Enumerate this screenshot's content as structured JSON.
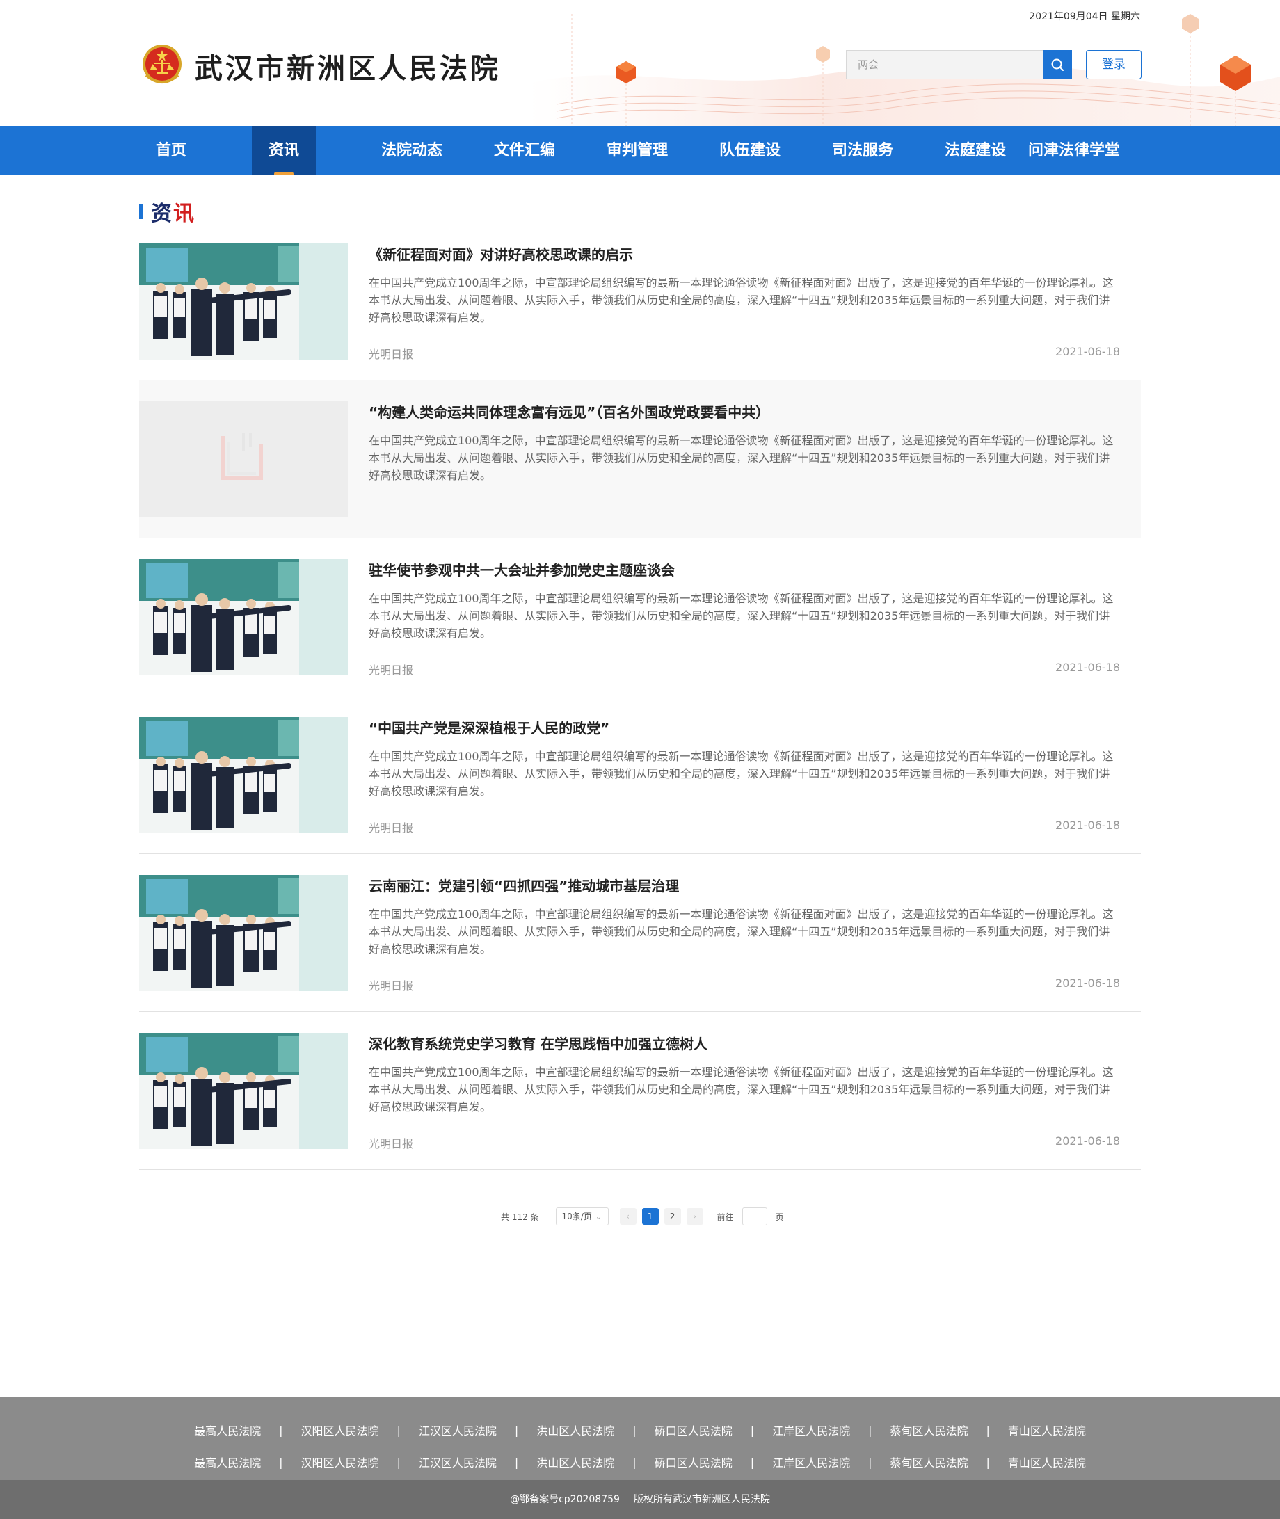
{
  "header": {
    "date": "2021年09月04日 星期六",
    "site_title": "武汉市新洲区人民法院",
    "search_placeholder": "两会",
    "login_label": "登录"
  },
  "nav": {
    "items": [
      {
        "label": "首页"
      },
      {
        "label": "资讯"
      },
      {
        "label": "法院动态"
      },
      {
        "label": "文件汇编"
      },
      {
        "label": "审判管理"
      },
      {
        "label": "队伍建设"
      },
      {
        "label": "司法服务"
      },
      {
        "label": "法庭建设"
      },
      {
        "label": "问津法律学堂"
      }
    ],
    "active_index": 1
  },
  "section": {
    "title_part1": "资",
    "title_part2": "讯"
  },
  "articles": [
    {
      "title": "《新征程面对面》对讲好高校思政课的启示",
      "summary": "在中国共产党成立100周年之际，中宣部理论局组织编写的最新一本理论通俗读物《新征程面对面》出版了，这是迎接党的百年华诞的一份理论厚礼。这本书从大局出发、从问题着眼、从实际入手，带领我们从历史和全局的高度，深入理解“十四五”规划和2035年远景目标的一系列重大问题，对于我们讲好高校思政课深有启发。",
      "source": "光明日报",
      "date": "2021-06-18",
      "has_image": true
    },
    {
      "title": "“构建人类命运共同体理念富有远见”（百名外国政党政要看中共）",
      "summary": "在中国共产党成立100周年之际，中宣部理论局组织编写的最新一本理论通俗读物《新征程面对面》出版了，这是迎接党的百年华诞的一份理论厚礼。这本书从大局出发、从问题着眼、从实际入手，带领我们从历史和全局的高度，深入理解“十四五”规划和2035年远景目标的一系列重大问题，对于我们讲好高校思政课深有启发。",
      "source": "",
      "date": "",
      "has_image": false
    },
    {
      "title": "驻华使节参观中共一大会址并参加党史主题座谈会",
      "summary": "在中国共产党成立100周年之际，中宣部理论局组织编写的最新一本理论通俗读物《新征程面对面》出版了，这是迎接党的百年华诞的一份理论厚礼。这本书从大局出发、从问题着眼、从实际入手，带领我们从历史和全局的高度，深入理解“十四五”规划和2035年远景目标的一系列重大问题，对于我们讲好高校思政课深有启发。",
      "source": "光明日报",
      "date": "2021-06-18",
      "has_image": true
    },
    {
      "title": "“中国共产党是深深植根于人民的政党”",
      "summary": "在中国共产党成立100周年之际，中宣部理论局组织编写的最新一本理论通俗读物《新征程面对面》出版了，这是迎接党的百年华诞的一份理论厚礼。这本书从大局出发、从问题着眼、从实际入手，带领我们从历史和全局的高度，深入理解“十四五”规划和2035年远景目标的一系列重大问题，对于我们讲好高校思政课深有启发。",
      "source": "光明日报",
      "date": "2021-06-18",
      "has_image": true
    },
    {
      "title": "云南丽江：党建引领“四抓四强”推动城市基层治理",
      "summary": "在中国共产党成立100周年之际，中宣部理论局组织编写的最新一本理论通俗读物《新征程面对面》出版了，这是迎接党的百年华诞的一份理论厚礼。这本书从大局出发、从问题着眼、从实际入手，带领我们从历史和全局的高度，深入理解“十四五”规划和2035年远景目标的一系列重大问题，对于我们讲好高校思政课深有启发。",
      "source": "光明日报",
      "date": "2021-06-18",
      "has_image": true
    },
    {
      "title": "深化教育系统党史学习教育 在学思践悟中加强立德树人",
      "summary": "在中国共产党成立100周年之际，中宣部理论局组织编写的最新一本理论通俗读物《新征程面对面》出版了，这是迎接党的百年华诞的一份理论厚礼。这本书从大局出发、从问题着眼、从实际入手，带领我们从历史和全局的高度，深入理解“十四五”规划和2035年远景目标的一系列重大问题，对于我们讲好高校思政课深有启发。",
      "source": "光明日报",
      "date": "2021-06-18",
      "has_image": true
    }
  ],
  "pagination": {
    "total_text": "共 112 条",
    "page_size": "10条/页",
    "prev": "‹",
    "pages": [
      "1",
      "2"
    ],
    "current": "1",
    "next": "›",
    "goto_label": "前往",
    "page_unit": "页"
  },
  "footer": {
    "row1": [
      "最高人民法院",
      "汉阳区人民法院",
      "江汉区人民法院",
      "洪山区人民法院",
      "硚口区人民法院",
      "江岸区人民法院",
      "蔡甸区人民法院",
      "青山区人民法院"
    ],
    "row2": [
      "最高人民法院",
      "汉阳区人民法院",
      "江汉区人民法院",
      "洪山区人民法院",
      "硚口区人民法院",
      "江岸区人民法院",
      "蔡甸区人民法院",
      "青山区人民法院"
    ],
    "separator": "|",
    "icp": "@鄂备案号cp20208759",
    "copyright": "版权所有武汉市新洲区人民法院"
  },
  "colors": {
    "primary": "#1c73d4",
    "nav_active": "#0f4a95",
    "accent_red": "#d21f1f",
    "footer": "#8b8b8b",
    "footer_bottom": "#6e6e6e"
  },
  "icons": {
    "emblem": "court-emblem-icon",
    "search": "search-icon",
    "thumbnail_placeholder": "image-placeholder-icon"
  }
}
